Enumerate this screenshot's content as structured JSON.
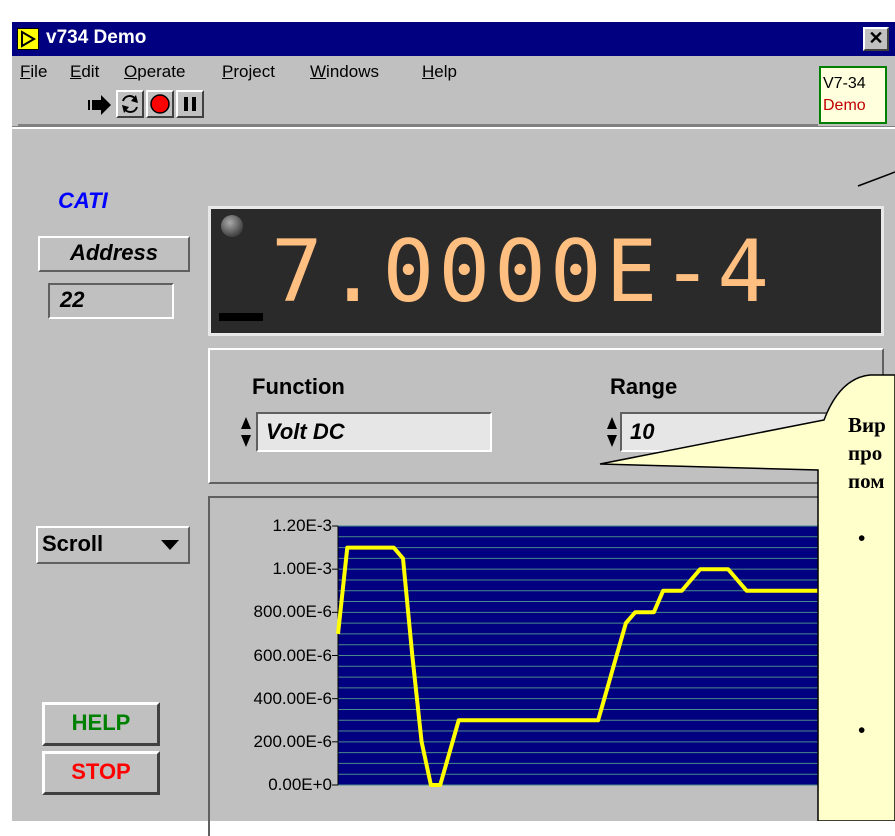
{
  "window": {
    "title": "v734 Demo",
    "close": "✕"
  },
  "menu": [
    {
      "key": "F",
      "rest": "ile"
    },
    {
      "key": "E",
      "rest": "dit"
    },
    {
      "key": "O",
      "rest": "perate"
    },
    {
      "key": "P",
      "rest": "roject"
    },
    {
      "key": "W",
      "rest": "indows"
    },
    {
      "key": "H",
      "rest": "elp"
    }
  ],
  "toolbar": {
    "icons": [
      "run-arrow-icon",
      "continuous-run-icon",
      "abort-icon",
      "pause-icon"
    ]
  },
  "badge": {
    "line1": "V7-34",
    "line2": "Demo"
  },
  "instrument": {
    "name": "CATI",
    "address_label": "Address",
    "address_value": "22",
    "reading": "7.0000E-4",
    "function_label": "Function",
    "function_value": "Volt DC",
    "range_label": "Range",
    "range_value": "10",
    "scroll_label": "Scroll",
    "help_label": "HELP",
    "stop_label": "STOP"
  },
  "callout": {
    "lines": [
      "Вир",
      "про",
      "пом"
    ],
    "bullets": [
      "•",
      "•"
    ]
  },
  "colors": {
    "title_bar": "#000080",
    "reading": "#ffbf80",
    "trace": "#ffff00",
    "cati": "#0000ff",
    "help": "#008000",
    "stop": "#ff0000",
    "callout_bg": "#ffffcc"
  },
  "chart_data": {
    "type": "line",
    "y_tick_labels": [
      "1.20E-3",
      "1.00E-3",
      "800.00E-6",
      "600.00E-6",
      "400.00E-6",
      "200.00E-6",
      "0.00E+0"
    ],
    "ylim": [
      0,
      0.0012
    ],
    "grid": true,
    "series": [
      {
        "values": [
          0.0007,
          0.0011,
          0.0011,
          0.0011,
          0.0011,
          0.0011,
          0.0011,
          0.00105,
          0.0006,
          0.0002,
          0.0,
          0.0,
          0.00015,
          0.0003,
          0.0003,
          0.0003,
          0.0003,
          0.0003,
          0.0003,
          0.0003,
          0.0003,
          0.0003,
          0.0003,
          0.0003,
          0.0003,
          0.0003,
          0.0003,
          0.0003,
          0.0003,
          0.00045,
          0.0006,
          0.00075,
          0.0008,
          0.0008,
          0.0008,
          0.0009,
          0.0009,
          0.0009,
          0.00095,
          0.001,
          0.001,
          0.001,
          0.001,
          0.00095,
          0.0009,
          0.0009,
          0.0009,
          0.0009,
          0.0009,
          0.0009,
          0.0009,
          0.0009,
          0.0009,
          0.0009,
          0.00085,
          0.0008,
          0.0008,
          0.0008,
          0.0008,
          0.0008
        ]
      }
    ]
  }
}
